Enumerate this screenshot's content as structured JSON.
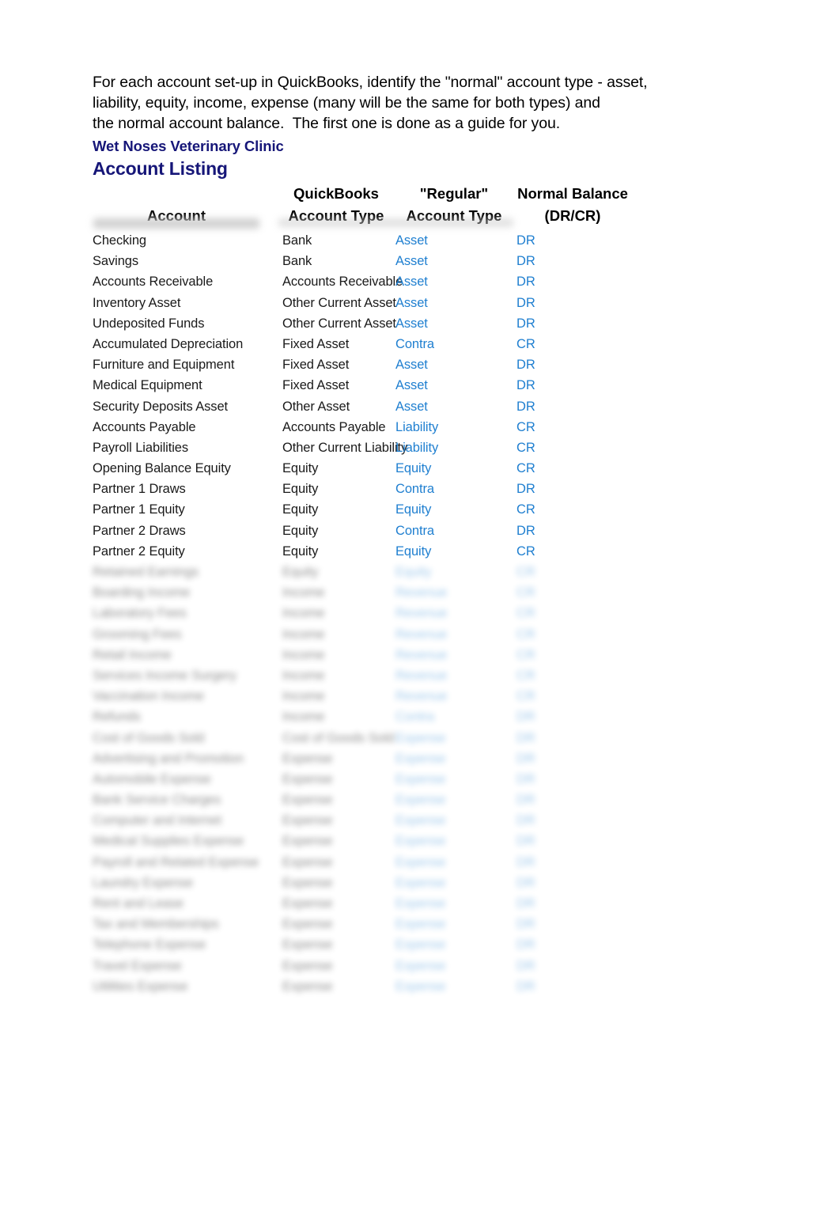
{
  "intro": {
    "lines": [
      "For each account set-up in QuickBooks, identify the \"normal\" account type - asset,",
      "liability, equity, income, expense (many will be the same for both types) and",
      "the normal account balance.  The first one is done as a guide for you."
    ]
  },
  "titles": {
    "company": "Wet Noses Veterinary Clinic",
    "report": "Account Listing"
  },
  "colors": {
    "heading_navy": "#161678",
    "answer_blue": "#1F7FD0",
    "body_text": "#1A1A1A"
  },
  "table": {
    "headers": {
      "account": "Account",
      "qb_type_line1": "QuickBooks",
      "qb_type_line2": "Account Type",
      "regular_type_line1": "\"Regular\"",
      "regular_type_line2": "Account Type",
      "balance_line1": "Normal Balance",
      "balance_line2": "(DR/CR)"
    },
    "rows": [
      {
        "account": "Checking",
        "qb_type": "Bank",
        "regular_type": "Asset",
        "balance": "DR",
        "redacted": false
      },
      {
        "account": "Savings",
        "qb_type": "Bank",
        "regular_type": "Asset",
        "balance": "DR",
        "redacted": false
      },
      {
        "account": "Accounts Receivable",
        "qb_type": "Accounts Receivable",
        "regular_type": "Asset",
        "balance": "DR",
        "redacted": false
      },
      {
        "account": "Inventory Asset",
        "qb_type": "Other Current Asset",
        "regular_type": "Asset",
        "balance": "DR",
        "redacted": false
      },
      {
        "account": "Undeposited Funds",
        "qb_type": "Other Current Asset",
        "regular_type": "Asset",
        "balance": "DR",
        "redacted": false
      },
      {
        "account": "Accumulated Depreciation",
        "qb_type": "Fixed Asset",
        "regular_type": "Contra",
        "balance": "CR",
        "redacted": false
      },
      {
        "account": "Furniture and Equipment",
        "qb_type": "Fixed Asset",
        "regular_type": "Asset",
        "balance": "DR",
        "redacted": false
      },
      {
        "account": "Medical Equipment",
        "qb_type": "Fixed Asset",
        "regular_type": "Asset",
        "balance": "DR",
        "redacted": false
      },
      {
        "account": "Security Deposits Asset",
        "qb_type": "Other Asset",
        "regular_type": "Asset",
        "balance": "DR",
        "redacted": false
      },
      {
        "account": "Accounts Payable",
        "qb_type": "Accounts Payable",
        "regular_type": "Liability",
        "balance": "CR",
        "redacted": false
      },
      {
        "account": "Payroll Liabilities",
        "qb_type": "Other Current Liability",
        "regular_type": "Liability",
        "balance": "CR",
        "redacted": false
      },
      {
        "account": "Opening Balance Equity",
        "qb_type": "Equity",
        "regular_type": "Equity",
        "balance": "CR",
        "redacted": false
      },
      {
        "account": "Partner 1 Draws",
        "qb_type": "Equity",
        "regular_type": "Contra",
        "balance": "DR",
        "redacted": false
      },
      {
        "account": "Partner 1 Equity",
        "qb_type": "Equity",
        "regular_type": "Equity",
        "balance": "CR",
        "redacted": false
      },
      {
        "account": "Partner 2 Draws",
        "qb_type": "Equity",
        "regular_type": "Contra",
        "balance": "DR",
        "redacted": false
      },
      {
        "account": "Partner 2 Equity",
        "qb_type": "Equity",
        "regular_type": "Equity",
        "balance": "CR",
        "redacted": false
      },
      {
        "account": "Retained Earnings",
        "qb_type": "Equity",
        "regular_type": "Equity",
        "balance": "CR",
        "redacted": true
      },
      {
        "account": "Boarding Income",
        "qb_type": "Income",
        "regular_type": "Revenue",
        "balance": "CR",
        "redacted": true
      },
      {
        "account": "Laboratory Fees",
        "qb_type": "Income",
        "regular_type": "Revenue",
        "balance": "CR",
        "redacted": true
      },
      {
        "account": "Grooming Fees",
        "qb_type": "Income",
        "regular_type": "Revenue",
        "balance": "CR",
        "redacted": true
      },
      {
        "account": "Retail Income",
        "qb_type": "Income",
        "regular_type": "Revenue",
        "balance": "CR",
        "redacted": true
      },
      {
        "account": "Services Income Surgery",
        "qb_type": "Income",
        "regular_type": "Revenue",
        "balance": "CR",
        "redacted": true
      },
      {
        "account": "Vaccination Income",
        "qb_type": "Income",
        "regular_type": "Revenue",
        "balance": "CR",
        "redacted": true
      },
      {
        "account": "Refunds",
        "qb_type": "Income",
        "regular_type": "Contra",
        "balance": "DR",
        "redacted": true
      },
      {
        "account": "Cost of Goods Sold",
        "qb_type": "Cost of Goods Sold",
        "regular_type": "Expense",
        "balance": "DR",
        "redacted": true
      },
      {
        "account": "Advertising and Promotion",
        "qb_type": "Expense",
        "regular_type": "Expense",
        "balance": "DR",
        "redacted": true
      },
      {
        "account": "Automobile Expense",
        "qb_type": "Expense",
        "regular_type": "Expense",
        "balance": "DR",
        "redacted": true
      },
      {
        "account": "Bank Service Charges",
        "qb_type": "Expense",
        "regular_type": "Expense",
        "balance": "DR",
        "redacted": true
      },
      {
        "account": "Computer and Internet",
        "qb_type": "Expense",
        "regular_type": "Expense",
        "balance": "DR",
        "redacted": true
      },
      {
        "account": "Medical Supplies Expense",
        "qb_type": "Expense",
        "regular_type": "Expense",
        "balance": "DR",
        "redacted": true
      },
      {
        "account": "Payroll and Related Expense",
        "qb_type": "Expense",
        "regular_type": "Expense",
        "balance": "DR",
        "redacted": true
      },
      {
        "account": "Laundry Expense",
        "qb_type": "Expense",
        "regular_type": "Expense",
        "balance": "DR",
        "redacted": true
      },
      {
        "account": "Rent and Lease",
        "qb_type": "Expense",
        "regular_type": "Expense",
        "balance": "DR",
        "redacted": true
      },
      {
        "account": "Tax and Memberships",
        "qb_type": "Expense",
        "regular_type": "Expense",
        "balance": "DR",
        "redacted": true
      },
      {
        "account": "Telephone Expense",
        "qb_type": "Expense",
        "regular_type": "Expense",
        "balance": "DR",
        "redacted": true
      },
      {
        "account": "Travel Expense",
        "qb_type": "Expense",
        "regular_type": "Expense",
        "balance": "DR",
        "redacted": true
      },
      {
        "account": "Utilities Expense",
        "qb_type": "Expense",
        "regular_type": "Expense",
        "balance": "DR",
        "redacted": true
      }
    ]
  }
}
